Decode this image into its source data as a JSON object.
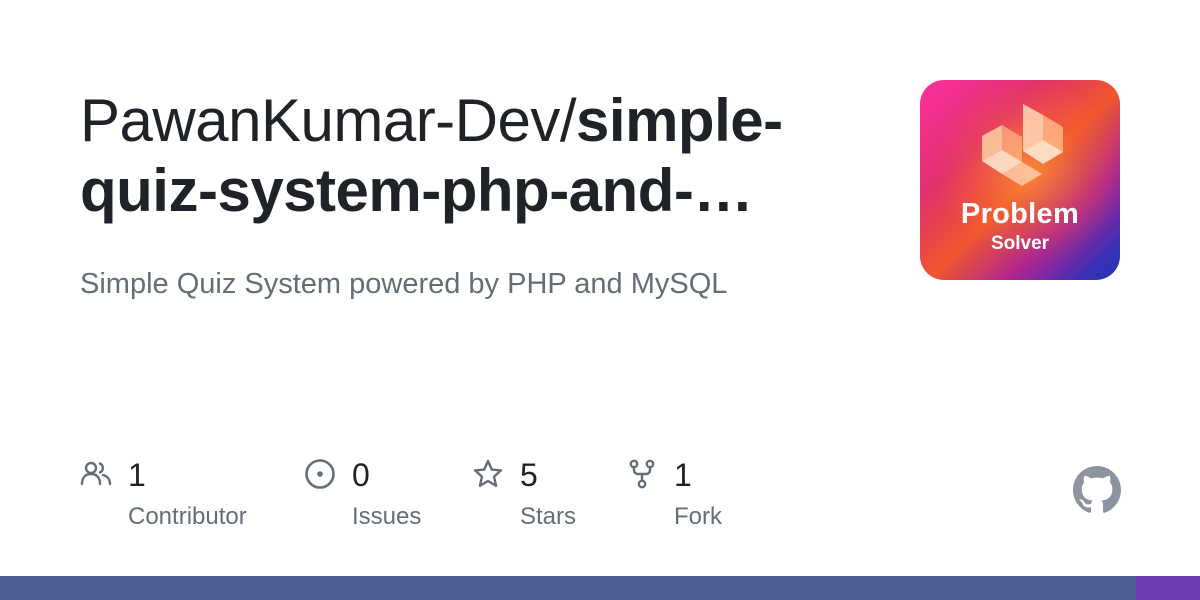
{
  "repo": {
    "owner": "PawanKumar-Dev/",
    "name_line1": "simple-",
    "name_line2": "quiz-system-php-and-…",
    "description": "Simple Quiz System powered by PHP and MySQL"
  },
  "avatar": {
    "title": "Problem",
    "subtitle": "Solver"
  },
  "stats": [
    {
      "count": "1",
      "label": "Contributor",
      "icon": "people-icon"
    },
    {
      "count": "0",
      "label": "Issues",
      "icon": "issue-opened-icon"
    },
    {
      "count": "5",
      "label": "Stars",
      "icon": "star-icon"
    },
    {
      "count": "1",
      "label": "Fork",
      "icon": "repo-forked-icon"
    }
  ],
  "logo": {
    "icon": "github-mark-icon"
  },
  "language_bar": {
    "segments": [
      {
        "color": "#4F5D95",
        "fraction": 0.947
      },
      {
        "color": "#6e3cb4",
        "fraction": 0.053
      }
    ]
  },
  "colors": {
    "title": "#1f2328",
    "muted": "#656d76"
  }
}
